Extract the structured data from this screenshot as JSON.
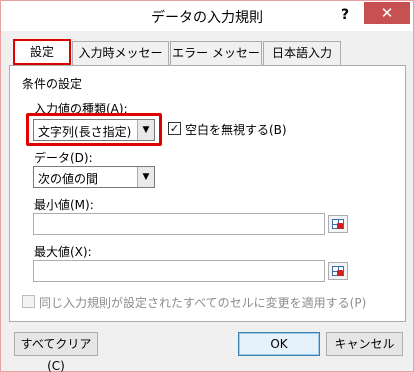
{
  "window": {
    "title": "データの入力規則",
    "help_label": "?",
    "close_label": "✕"
  },
  "tabs": [
    {
      "label": "設定",
      "active": true
    },
    {
      "label": "入力時メッセージ",
      "active": false
    },
    {
      "label": "エラー メッセージ",
      "active": false
    },
    {
      "label": "日本語入力",
      "active": false
    }
  ],
  "settings": {
    "group_label": "条件の設定",
    "allow_label": "入力値の種類(A):",
    "allow_value": "文字列(長さ指定)",
    "ignore_blank_label": "空白を無視する(B)",
    "ignore_blank_checked": true,
    "data_label": "データ(D):",
    "data_value": "次の値の間",
    "min_label": "最小値(M):",
    "min_value": "",
    "max_label": "最大値(X):",
    "max_value": "",
    "apply_all_label": "同じ入力規則が設定されたすべてのセルに変更を適用する(P)",
    "apply_all_checked": false
  },
  "buttons": {
    "clear_all": "すべてクリア(C)",
    "ok": "OK",
    "cancel": "キャンセル"
  },
  "icons": {
    "dropdown": "chevron-down-icon",
    "range_select": "range-select-icon",
    "check": "checkmark-icon"
  },
  "colors": {
    "highlight": "#e00000",
    "close_button": "#c75050"
  }
}
